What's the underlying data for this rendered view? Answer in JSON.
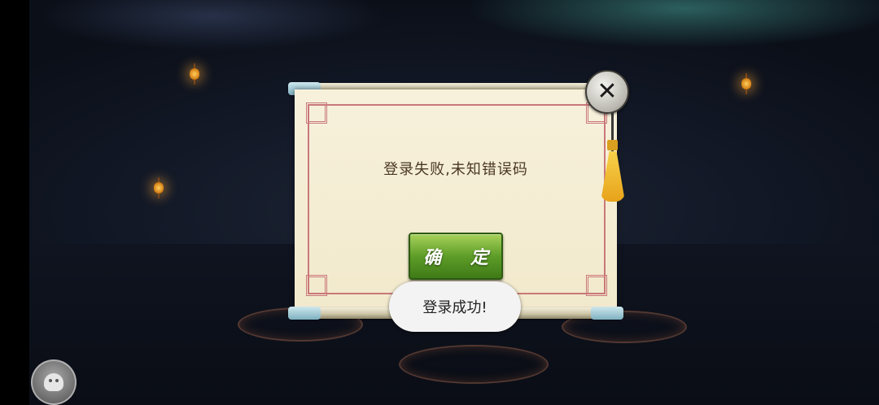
{
  "dialog": {
    "message": "登录失败,未知错误码",
    "confirm_label": "确 定",
    "close_icon": "close-icon"
  },
  "toast": {
    "text": "登录成功!"
  },
  "floating_assist_icon": "assistant-icon",
  "colors": {
    "parchment": "#f4ecd2",
    "border_red": "#c9787a",
    "button_green": "#5e9d28",
    "night_sky": "#121826"
  }
}
